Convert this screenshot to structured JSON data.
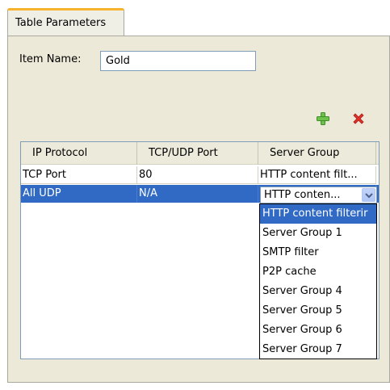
{
  "tab": {
    "label": "Table Parameters"
  },
  "item_name": {
    "label": "Item Name:",
    "value": "Gold"
  },
  "toolbar": {
    "add_icon": "plus-icon",
    "delete_icon": "close-icon"
  },
  "table": {
    "columns": [
      "IP Protocol",
      "TCP/UDP Port",
      "Server Group"
    ],
    "rows": [
      {
        "protocol": "TCP Port",
        "port": "80",
        "server_group": "HTTP content filt..."
      },
      {
        "protocol": "All UDP",
        "port": "N/A",
        "server_group": "HTTP conten..."
      }
    ]
  },
  "dropdown": {
    "options": [
      "HTTP content filterir",
      "Server Group 1",
      "SMTP filter",
      "P2P cache",
      "Server Group 4",
      "Server Group 5",
      "Server Group 6",
      "Server Group 7"
    ],
    "selected_index": 0
  },
  "colors": {
    "selection": "#316ac5",
    "tab_accent": "#f7b32e",
    "panel_bg": "#ece9d8",
    "add_icon": "#4caf3a",
    "delete_icon": "#e0312a"
  }
}
